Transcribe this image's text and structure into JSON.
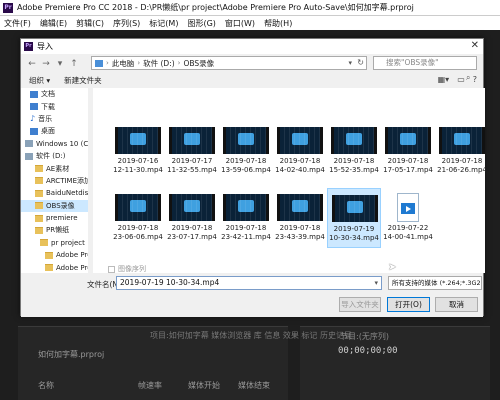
{
  "app": {
    "logo": "Pr",
    "title": "Adobe Premiere Pro CC 2018 - D:\\PR懒纸\\pr project\\Adobe Premiere Pro Auto-Save\\如何加字幕.prproj",
    "menu": [
      "文件(F)",
      "编辑(E)",
      "剪辑(C)",
      "序列(S)",
      "标记(M)",
      "图形(G)",
      "窗口(W)",
      "帮助(H)"
    ],
    "project_name": "如何加字幕.prproj",
    "tabs": "项目:如何加字幕   媒体浏览器   库   信息   效果   标记   历史记录",
    "columns": {
      "name": "名称",
      "framerate": "帧速率",
      "media_start": "媒体开始",
      "media_end": "媒体结束"
    },
    "sequence_label": "节目:(无序列)",
    "timecode": "00;00;00;00"
  },
  "dialog": {
    "title": "导入",
    "address": [
      "此电脑",
      "软件 (D:)",
      "OBS录像"
    ],
    "search_placeholder": "搜索\"OBS录像\"",
    "toolbar": {
      "organize": "组织 ▾",
      "new_folder": "新建文件夹"
    },
    "sidebar": [
      {
        "label": "文档",
        "icon": "documents-icon",
        "indent": 1
      },
      {
        "label": "下载",
        "icon": "downloads-icon",
        "indent": 1
      },
      {
        "label": "音乐",
        "icon": "music-icon",
        "indent": 1
      },
      {
        "label": "桌面",
        "icon": "desktop-icon",
        "indent": 1
      },
      {
        "label": "Windows 10 (C",
        "icon": "drive-icon",
        "indent": 0
      },
      {
        "label": "软件 (D:)",
        "icon": "drive-icon",
        "indent": 0
      },
      {
        "label": "AE素材",
        "icon": "folder-icon",
        "indent": 2
      },
      {
        "label": "ARCTIME添加",
        "icon": "folder-icon",
        "indent": 2
      },
      {
        "label": "BaiduNetdisk",
        "icon": "folder-icon",
        "indent": 2
      },
      {
        "label": "OBS录像",
        "icon": "folder-icon",
        "indent": 2,
        "selected": true
      },
      {
        "label": "premiere",
        "icon": "folder-icon",
        "indent": 2
      },
      {
        "label": "PR懒纸",
        "icon": "folder-icon",
        "indent": 2
      },
      {
        "label": "pr project",
        "icon": "folder-icon",
        "indent": 3
      },
      {
        "label": "Adobe Pre",
        "icon": "folder-icon",
        "indent": 4
      },
      {
        "label": "Adobe Pre",
        "icon": "folder-icon",
        "indent": 4
      }
    ],
    "files": [
      {
        "name": "2019-07-16\n12-11-30.mp4",
        "kind": "video"
      },
      {
        "name": "2019-07-17\n11-32-55.mp4",
        "kind": "video"
      },
      {
        "name": "2019-07-18\n13-59-06.mp4",
        "kind": "video"
      },
      {
        "name": "2019-07-18\n14-02-40.mp4",
        "kind": "video"
      },
      {
        "name": "2019-07-18\n15-52-35.mp4",
        "kind": "video"
      },
      {
        "name": "2019-07-18\n17-05-17.mp4",
        "kind": "video"
      },
      {
        "name": "2019-07-18\n21-06-26.mp4",
        "kind": "video"
      },
      {
        "name": "2019-07-18\n23-06-06.mp4",
        "kind": "video"
      },
      {
        "name": "2019-07-18\n23-07-17.mp4",
        "kind": "video"
      },
      {
        "name": "2019-07-18\n23-42-11.mp4",
        "kind": "video"
      },
      {
        "name": "2019-07-18\n23-43-39.mp4",
        "kind": "video"
      },
      {
        "name": "2019-07-19\n10-30-34.mp4",
        "kind": "video",
        "selected": true
      },
      {
        "name": "2019-07-22\n14-00-41.mp4",
        "kind": "doc"
      }
    ],
    "preview_label": "图像序列",
    "filename_label": "文件名(N):",
    "filename_value": "2019-07-19 10-30-34.mp4",
    "filetype_value": "所有支持的媒体 (*.264;*.3G2;*",
    "buttons": {
      "import_folder": "导入文件夹",
      "open": "打开(O)",
      "cancel": "取消"
    }
  }
}
